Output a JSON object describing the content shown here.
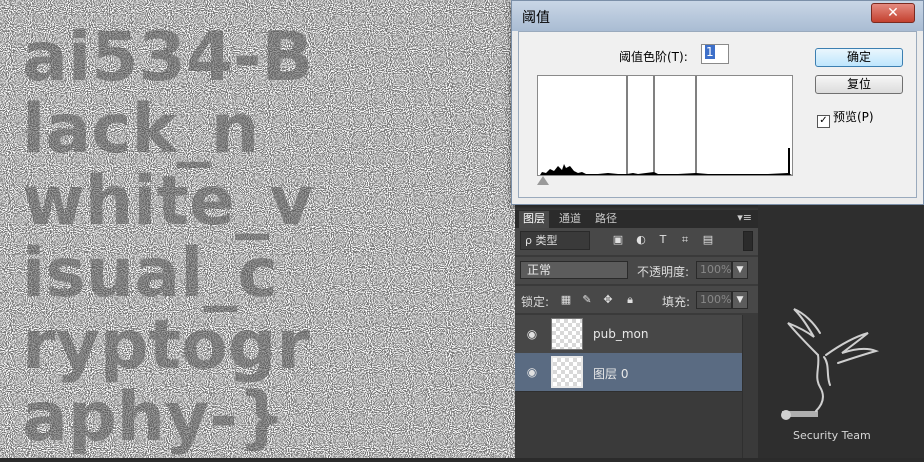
{
  "dialog": {
    "title": "阈值",
    "close_glyph": "✕",
    "threshold_label": "阈值色阶(T):",
    "threshold_value": "1",
    "ok_label": "确定",
    "reset_label": "复位",
    "preview_label": "预览(P)",
    "preview_checked": true
  },
  "layers_panel": {
    "tabs": [
      {
        "label": "图层",
        "active": true
      },
      {
        "label": "通道",
        "active": false
      },
      {
        "label": "路径",
        "active": false
      }
    ],
    "menu_icon": "panel-menu-icon",
    "filter_label": "ρ 类型",
    "blend_mode": "正常",
    "opacity_label": "不透明度:",
    "opacity_value": "100%",
    "lock_label": "锁定:",
    "fill_label": "填充:",
    "fill_value": "100%",
    "layers": [
      {
        "name": "pub_mon",
        "selected": false
      },
      {
        "name": "图层 0",
        "selected": true
      }
    ]
  },
  "watermark": {
    "text": "Security Team"
  },
  "canvas": {
    "lines": [
      "ai534-B",
      "lack_n",
      "white_v",
      "isual_c",
      "ryptogr",
      "aphy-}"
    ]
  },
  "colors": {
    "dialog_title_bar": "#b8c9de",
    "close_button": "#c9513f",
    "selected_layer": "#5a6b82",
    "panel_bg": "#3a3a3a"
  }
}
